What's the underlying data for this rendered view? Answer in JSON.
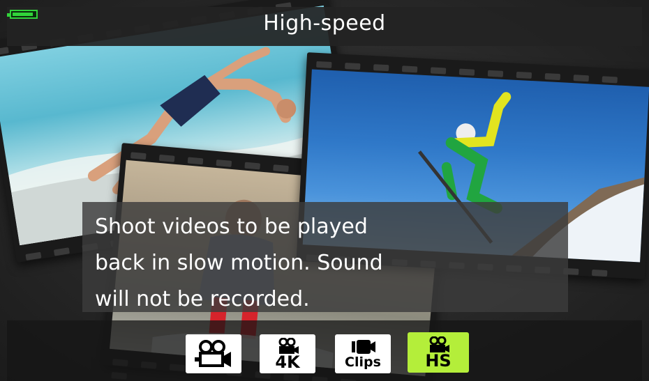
{
  "header": {
    "title": "High-speed"
  },
  "description": {
    "lines": [
      "Shoot videos to be played",
      "back in slow motion. Sound",
      "will not be recorded."
    ]
  },
  "modes": [
    {
      "id": "movie",
      "label": "",
      "icon": "movie-camera-icon",
      "selected": false
    },
    {
      "id": "4k",
      "label": "4K",
      "icon": "movie-camera-icon",
      "selected": false
    },
    {
      "id": "clips",
      "label": "Clips",
      "icon": "clips-camera-icon",
      "selected": false
    },
    {
      "id": "hs",
      "label": "HS",
      "icon": "movie-camera-icon",
      "selected": true
    }
  ],
  "colors": {
    "battery": "#31d43a",
    "selected_mode": "#b4ee3a",
    "mode_button": "#ffffff",
    "text": "#ffffff"
  },
  "status": {
    "battery_level": 0.9
  }
}
